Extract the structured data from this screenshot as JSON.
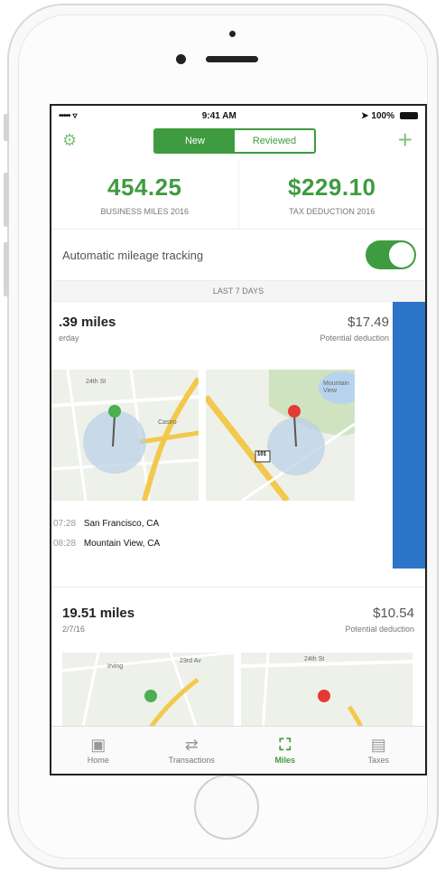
{
  "status_bar": {
    "signal": "•••••",
    "wifi": "▿",
    "time": "9:41 AM",
    "battery": "100%"
  },
  "header": {
    "tabs": [
      {
        "label": "New",
        "active": true
      },
      {
        "label": "Reviewed",
        "active": false
      }
    ]
  },
  "stats": [
    {
      "value": "454.25",
      "label": "BUSINESS MILES 2016"
    },
    {
      "value": "$229.10",
      "label": "TAX DEDUCTION 2016"
    }
  ],
  "tracking": {
    "label": "Automatic mileage tracking",
    "enabled": true
  },
  "section_label": "LAST 7 DAYS",
  "trips": [
    {
      "miles": ".39 miles",
      "date": "erday",
      "amount": "$17.49",
      "deduction_label": "Potential deduction",
      "map_labels": {
        "street": "24th St",
        "area": "Castro",
        "park": "Mountain View",
        "highway": "101"
      },
      "stops": [
        {
          "time": "07:28",
          "place": "San Francisco, CA"
        },
        {
          "time": "08:28",
          "place": "Mountain View, CA"
        }
      ]
    },
    {
      "miles": "19.51 miles",
      "date": "2/7/16",
      "amount": "$10.54",
      "deduction_label": "Potential deduction",
      "map_labels": {
        "street_a": "Irving",
        "street_b": "23rd Av",
        "street_c": "24th St"
      }
    }
  ],
  "tabbar": [
    {
      "label": "Home",
      "icon": "home-icon",
      "active": false
    },
    {
      "label": "Transactions",
      "icon": "transactions-icon",
      "active": false
    },
    {
      "label": "Miles",
      "icon": "car-icon",
      "active": true
    },
    {
      "label": "Taxes",
      "icon": "taxes-icon",
      "active": false
    }
  ],
  "colors": {
    "accent": "#3f9b3f",
    "swipe_action": "#2b74c7"
  }
}
